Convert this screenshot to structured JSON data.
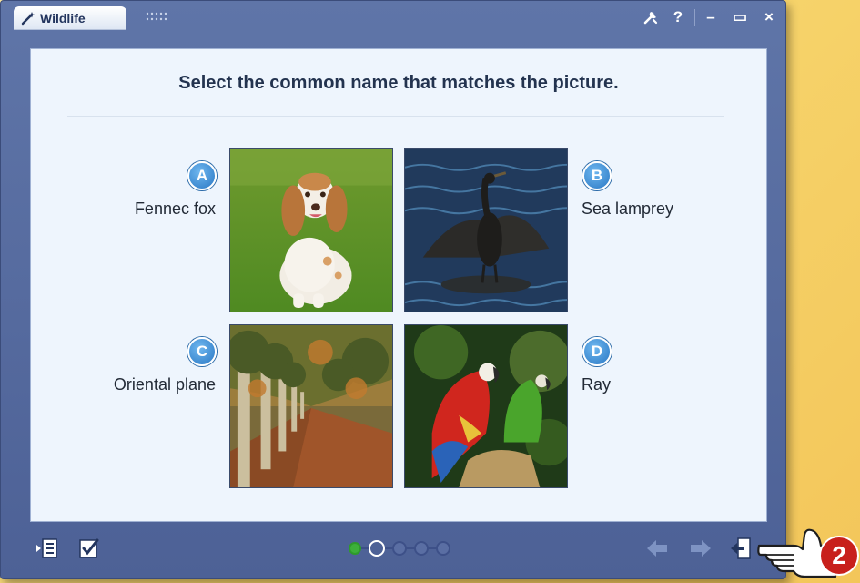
{
  "window": {
    "title": "Wildlife",
    "controls": {
      "tools_icon": "tools-icon",
      "help": "?",
      "minimize": "–",
      "maximize": "▭",
      "close": "×"
    }
  },
  "question": {
    "prompt": "Select the common name that matches the picture."
  },
  "choices": [
    {
      "letter": "A",
      "label": "Fennec fox",
      "image": "spaniel-dog-on-grass"
    },
    {
      "letter": "B",
      "label": "Sea lamprey",
      "image": "cormorant-spreading-wings"
    },
    {
      "letter": "C",
      "label": "Oriental plane",
      "image": "tree-lined-autumn-path"
    },
    {
      "letter": "D",
      "label": "Ray",
      "image": "two-macaw-parrots"
    }
  ],
  "footer": {
    "left_buttons": [
      "list-icon",
      "checkmark-edit-icon"
    ],
    "progress": {
      "total": 5,
      "completed": 1,
      "current": 2
    },
    "right_buttons": [
      "back-arrow-icon",
      "forward-arrow-icon",
      "exit-icon"
    ]
  },
  "callout": {
    "step": "2"
  },
  "colors": {
    "window": "#4d6196",
    "content_bg": "#eef5fd",
    "accent_blue": "#2a78c4",
    "done_green": "#3db03a",
    "callout_red": "#c8201c"
  }
}
